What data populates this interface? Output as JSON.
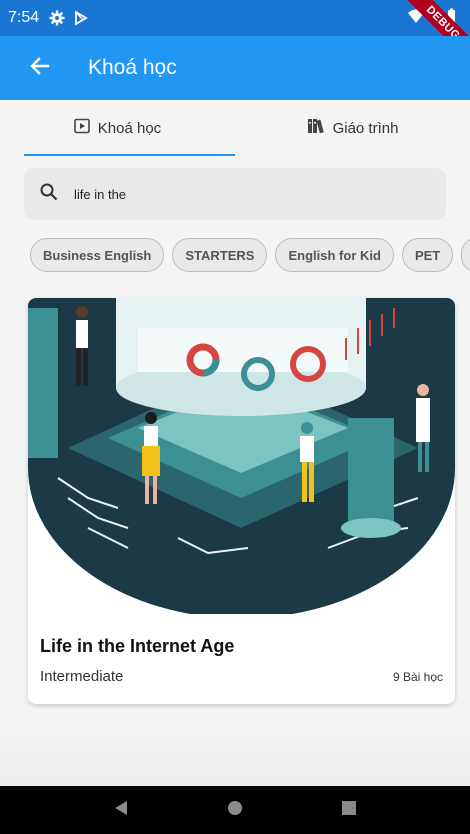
{
  "status_bar": {
    "time": "7:54",
    "debug_label": "DEBUG"
  },
  "app_bar": {
    "title": "Khoá học"
  },
  "tabs": [
    {
      "label": "Khoá học",
      "icon": "play-video-icon",
      "active": true
    },
    {
      "label": "Giáo trình",
      "icon": "books-icon",
      "active": false
    }
  ],
  "search": {
    "value": "life in the",
    "placeholder": ""
  },
  "chips": [
    "Business English",
    "STARTERS",
    "English for Kid",
    "PET"
  ],
  "course_card": {
    "title": "Life in the Internet Age",
    "level": "Intermediate",
    "lessons": "9 Bài học",
    "image": "internet-age-illustration"
  },
  "colors": {
    "status_bar": "#1976d2",
    "app_bar": "#2196f3",
    "accent": "#2196f3",
    "illustration_dark": "#1c3a46",
    "illustration_teal": "#3c8f93"
  }
}
